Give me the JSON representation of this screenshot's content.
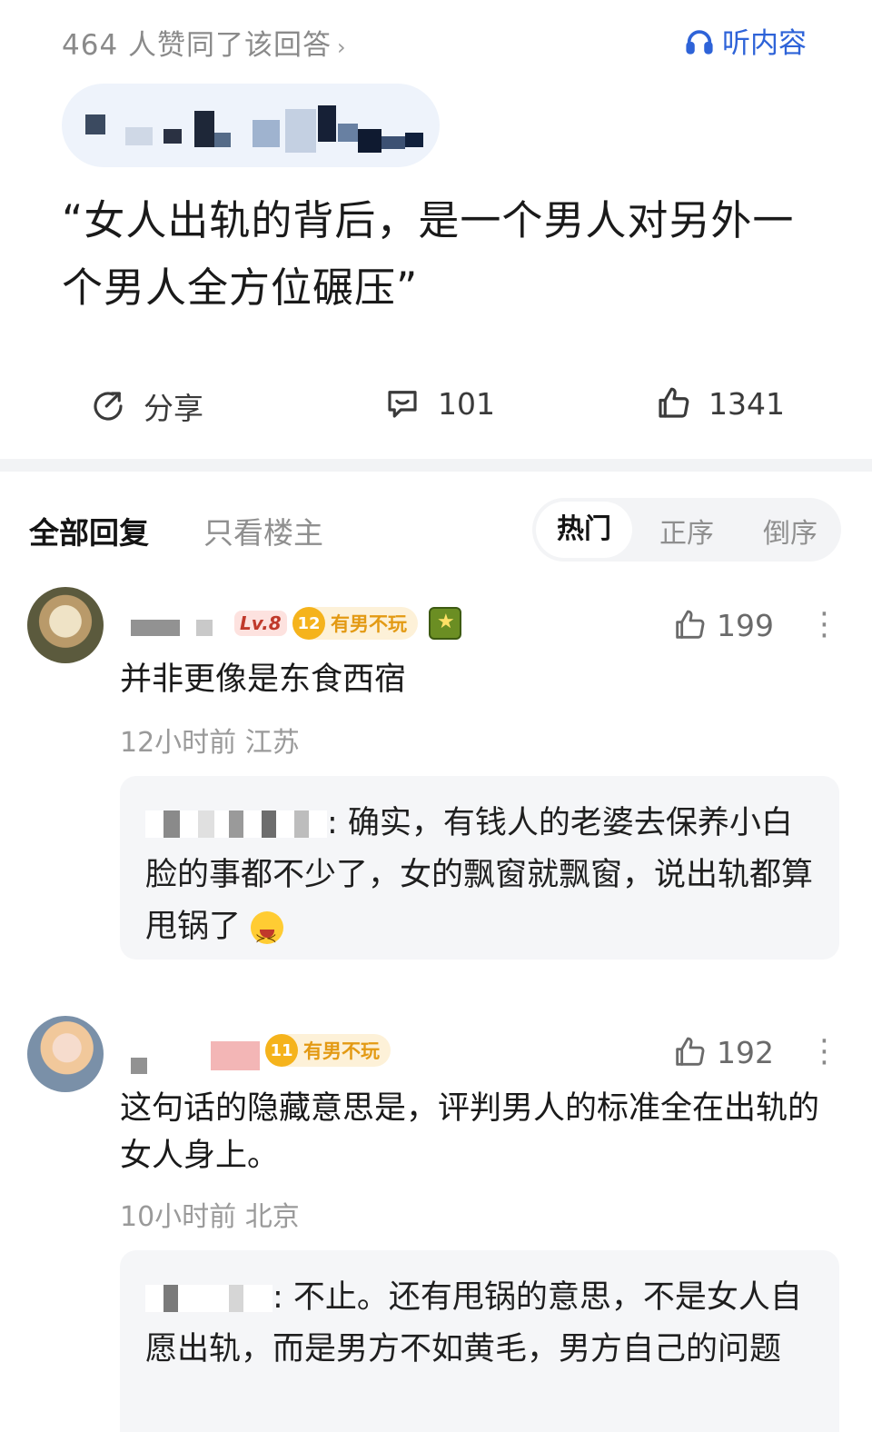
{
  "header": {
    "likes_summary": "464 人赞同了该回答",
    "chevron": "›",
    "listen_label": "听内容",
    "listen_icon": "headphones-icon"
  },
  "post": {
    "title": "“女人出轨的背后，是一个男人对另外一个男人全方位碾压”"
  },
  "actions": {
    "share_label": "分享",
    "comment_count": "101",
    "like_count": "1341"
  },
  "replies_tabs": {
    "all": "全部回复",
    "owner_only": "只看楼主",
    "sort": {
      "hot": "热门",
      "order": "正序",
      "reverse": "倒序"
    }
  },
  "comments": [
    {
      "level": "Lv.8",
      "fan_level": "12",
      "fan_badge": "有男不玩",
      "likes": "199",
      "text": "并非更像是东食西宿",
      "meta": "12小时前  江苏",
      "reply": {
        "text": ": 确实，有钱人的老婆去保养小白脸的事都不少了，女的飘窗就飘窗，说出轨都算甩锅了"
      }
    },
    {
      "fan_level": "11",
      "fan_badge": "有男不玩",
      "likes": "192",
      "text": "这句话的隐藏意思是，评判男人的标准全在出轨的女人身上。",
      "meta": "10小时前  北京",
      "reply": {
        "text": ": 不止。还有甩锅的意思，不是女人自愿出轨，而是男方不如黄毛，男方自己的问题"
      }
    }
  ]
}
